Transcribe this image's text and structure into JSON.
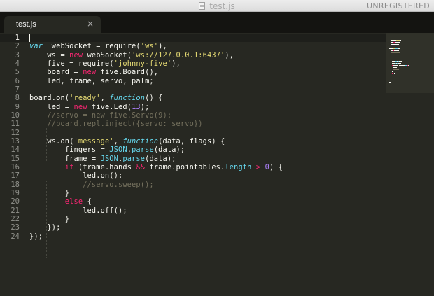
{
  "window": {
    "title": "test.js",
    "license_status": "UNREGISTERED"
  },
  "tabs": [
    {
      "label": "test.js",
      "close_glyph": "×"
    }
  ],
  "editor": {
    "active_line": 1,
    "line_numbers": [
      "1",
      "2",
      "3",
      "4",
      "5",
      "6",
      "7",
      "8",
      "9",
      "10",
      "11",
      "12",
      "13",
      "14",
      "15",
      "16",
      "17",
      "18",
      "19",
      "20",
      "21",
      "22",
      "23",
      "24"
    ],
    "lines": [
      [],
      [
        [
          "kw-i",
          "var"
        ],
        [
          "",
          "  webSocket = require("
        ],
        [
          "str",
          "'ws'"
        ],
        [
          "",
          "),"
        ]
      ],
      [
        [
          "",
          "    ws = "
        ],
        [
          "kw",
          "new"
        ],
        [
          "",
          " webSocket("
        ],
        [
          "str",
          "'ws://127.0.0.1:6437'"
        ],
        [
          "",
          "),"
        ]
      ],
      [
        [
          "",
          "    five = require("
        ],
        [
          "str",
          "'johnny-five'"
        ],
        [
          "",
          "),"
        ]
      ],
      [
        [
          "",
          "    board = "
        ],
        [
          "kw",
          "new"
        ],
        [
          "",
          " five.Board(),"
        ]
      ],
      [
        [
          "",
          "    led, frame, servo, palm;"
        ]
      ],
      [],
      [
        [
          "",
          "board.on("
        ],
        [
          "str",
          "'ready'"
        ],
        [
          "",
          ", "
        ],
        [
          "kw-i",
          "function"
        ],
        [
          "",
          "() {"
        ]
      ],
      [
        [
          "",
          "    led = "
        ],
        [
          "kw",
          "new"
        ],
        [
          "",
          " five.Led("
        ],
        [
          "num",
          "13"
        ],
        [
          "",
          ");"
        ]
      ],
      [
        [
          "cmt",
          "    //servo = new five.Servo(9);"
        ]
      ],
      [
        [
          "cmt",
          "    //board.repl.inject({servo: servo})"
        ]
      ],
      [],
      [
        [
          "",
          "    ws.on("
        ],
        [
          "str",
          "'message'"
        ],
        [
          "",
          ", "
        ],
        [
          "kw-i",
          "function"
        ],
        [
          "",
          "(data, flags) {"
        ]
      ],
      [
        [
          "",
          "        fingers = "
        ],
        [
          "sup",
          "JSON"
        ],
        [
          "",
          "."
        ],
        [
          "fn",
          "parse"
        ],
        [
          "",
          "(data);"
        ]
      ],
      [
        [
          "",
          "        frame = "
        ],
        [
          "sup",
          "JSON"
        ],
        [
          "",
          "."
        ],
        [
          "fn",
          "parse"
        ],
        [
          "",
          "(data);"
        ]
      ],
      [
        [
          "",
          "        "
        ],
        [
          "kw",
          "if"
        ],
        [
          "",
          " (frame.hands "
        ],
        [
          "kw",
          "&&"
        ],
        [
          "",
          " frame.pointables."
        ],
        [
          "fn",
          "length"
        ],
        [
          "",
          " "
        ],
        [
          "kw",
          ">"
        ],
        [
          "",
          " "
        ],
        [
          "num",
          "0"
        ],
        [
          "",
          ") {"
        ]
      ],
      [
        [
          "",
          "            led.on();"
        ]
      ],
      [
        [
          "cmt",
          "            //servo.sweep();"
        ]
      ],
      [
        [
          "",
          "        }"
        ]
      ],
      [
        [
          "",
          "        "
        ],
        [
          "kw",
          "else"
        ],
        [
          "",
          " {"
        ]
      ],
      [
        [
          "",
          "            led.off();"
        ]
      ],
      [
        [
          "",
          "        }"
        ]
      ],
      [
        [
          "",
          "    });"
        ]
      ],
      [
        [
          "",
          "});"
        ]
      ]
    ]
  },
  "syntax_colors": {
    "foreground": "#F8F8F2",
    "keyword": "#F92672",
    "storage_italic": "#66D9EF",
    "string": "#E6DB74",
    "number": "#AE81FF",
    "comment": "#75715E",
    "support": "#66D9EF",
    "background": "#272822"
  },
  "minimap_label": "minimap"
}
